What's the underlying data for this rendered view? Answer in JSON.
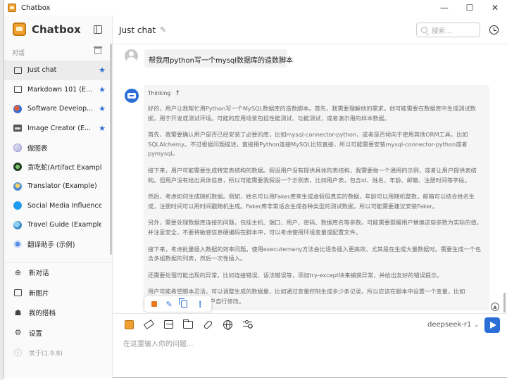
{
  "window": {
    "title": "Chatbox",
    "controls": {
      "minimize": "—",
      "maximize": "☐",
      "close": "✕"
    }
  },
  "sidebar": {
    "brand": "Chatbox",
    "section_label": "对话",
    "conversations": [
      {
        "label": "Just chat",
        "icon": "chat-bubble-icon",
        "starred": true,
        "active": true
      },
      {
        "label": "Markdown 101 (E...",
        "icon": "chat-bubble-icon",
        "starred": true
      },
      {
        "label": "Software Develop...",
        "icon": "developer-avatar-icon",
        "starred": true
      },
      {
        "label": "Image Creator (E...",
        "icon": "image-icon",
        "starred": true
      },
      {
        "label": "做图表",
        "icon": "chart-avatar-icon"
      },
      {
        "label": "贪吃蛇(Artifact Example)",
        "icon": "snake-avatar-icon"
      },
      {
        "label": "Translator (Example)",
        "icon": "translator-avatar-icon"
      },
      {
        "label": "Social Media Influence...",
        "icon": "twitter-avatar-icon"
      },
      {
        "label": "Travel Guide (Example)",
        "icon": "travel-avatar-icon"
      },
      {
        "label": "翻译助手 (示例)",
        "icon": "translate-avatar-icon"
      }
    ],
    "star_glyph": "★",
    "actions": {
      "new_chat": "新对话",
      "new_image": "新图片",
      "my_partners": "我的搭档",
      "settings": "设置",
      "about": "关于(1.9.8)"
    }
  },
  "header": {
    "title": "Just chat",
    "search_placeholder": "搜索..."
  },
  "messages": {
    "user": "帮我用python写一个mysql数据库的造数脚本",
    "thinking_label": "Thinking",
    "thinking_arrow": "↑",
    "paragraphs": [
      "好的，用户让我帮忙用Python写一个MySQL数据库的造数脚本。首先，我需要理解他的需求。他可能需要在数据库中生成测试数据，用于开发或测试环境。可能的应用场景包括性能测试、功能测试，或者演示用的样本数据。",
      "首先，我需要确认用户是否已经安装了必要的库，比如mysql-connector-python，或者是否倾向于使用其他ORM工具，比如SQLAlchemy。不过根据问题描述，直接用Python连接MySQL比较直接，所以可能需要安装mysql-connector-python或者pymysql。",
      "接下来，用户可能需要生成特定表结构的数据。假设用户没有提供具体的表结构，我需要做一个通用的示例，或者让用户提供表结构。但用户没有给出具体信息，所以可能需要我假设一个示例表，比如用户表，包含id、姓名、年龄、邮箱、注册时间等字段。",
      "然后，考虑如何生成随机数据。例如，姓名可以用Faker库来生成虚假但真实的数据，年龄可以用随机整数，邮箱可以结合姓名生成，注册时间可以用时间戳随机生成。Faker库非常适合生成各种类型的测试数据，所以可能需要建议安装Faker。",
      "另外，需要处理数据库连接的问题，包括主机、端口、用户、密码、数据库名等参数。可能需要提醒用户替换这些参数为实际的值，并注意安全，不要将敏感信息硬编码在脚本中，可以考虑使用环境变量或配置文件。",
      "接下来，考虑批量插入数据的效率问题。使用executemany方法会比逐条插入更高效，尤其是在生成大量数据时。需要生成一个包含多组数据的列表，然后一次性插入。",
      "还需要处理可能出现的异常，比如连接错误、语法错误等，添加try-except块来捕获异常，并给出友好的错误提示。",
      "用户可能希望脚本灵活，可以调整生成的数据量，比如通过变量控制生成多少条记录。所以应该在脚本中设置一个变量，比如NUM_RECORDS，让用户自行修改。"
    ]
  },
  "composer": {
    "model": "deepseek-r1",
    "model_chevron": "⌄",
    "placeholder": "在这里输入你的问题..."
  },
  "colors": {
    "accent": "#2b6fd6",
    "brand": "#f0a030",
    "stop": "#e8761c"
  }
}
